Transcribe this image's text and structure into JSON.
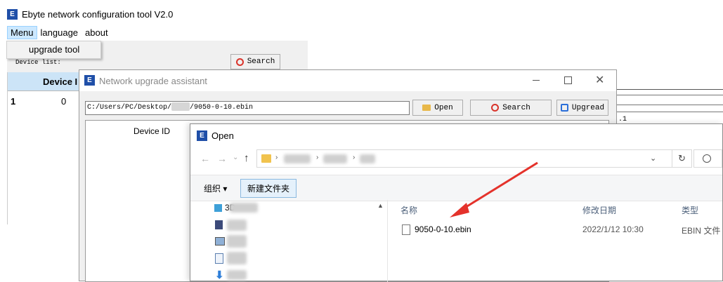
{
  "main_window": {
    "title": "Ebyte network configuration tool V2.0",
    "menu": [
      "Menu",
      "language",
      "about"
    ],
    "dropdown_item": "upgrade tool",
    "device_list_label": "Device list:",
    "search_label": "Search",
    "table": {
      "header": "Device I",
      "row_number": "1",
      "row_value": "0"
    },
    "side_value": ".1"
  },
  "upgrade_dialog": {
    "title": "Network upgrade assistant",
    "path_value_prefix": "C:/Users/PC/Desktop/",
    "path_value_suffix": "/9050-0-10.ebin",
    "open_label": "Open",
    "search_label": "Search",
    "upgrade_label": "Upgread",
    "device_id_header": "Device ID"
  },
  "open_dialog": {
    "title": "Open",
    "organize_label": "组织 ▾",
    "new_folder_label": "新建文件夹",
    "tree_item_label": "3D",
    "columns": {
      "name": "名称",
      "modified": "修改日期",
      "type": "类型"
    },
    "file": {
      "name": "9050-0-10.ebin",
      "modified": "2022/1/12 10:30",
      "type": "EBIN 文件"
    }
  }
}
